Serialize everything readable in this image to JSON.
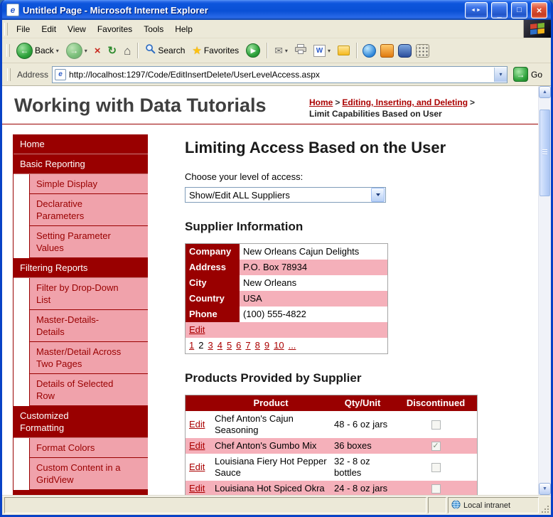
{
  "window": {
    "title": "Untitled Page - Microsoft Internet Explorer",
    "status_zone": "Local intranet"
  },
  "menu": {
    "items": [
      "File",
      "Edit",
      "View",
      "Favorites",
      "Tools",
      "Help"
    ]
  },
  "toolbar": {
    "back_label": "Back",
    "search_label": "Search",
    "favorites_label": "Favorites"
  },
  "address": {
    "label": "Address",
    "url": "http://localhost:1297/Code/EditInsertDelete/UserLevelAccess.aspx",
    "go_label": "Go"
  },
  "page": {
    "site_title": "Working with Data Tutorials",
    "breadcrumb": {
      "links": [
        "Home",
        "Editing, Inserting, and Deleting"
      ],
      "separator": ">",
      "current": "Limit Capabilities Based on User"
    },
    "sidebar": {
      "items": [
        {
          "label": "Home",
          "type": "section"
        },
        {
          "label": "Basic Reporting",
          "type": "section"
        },
        {
          "label": "Simple Display",
          "type": "item"
        },
        {
          "label": "Declarative Parameters",
          "type": "item"
        },
        {
          "label": "Setting Parameter Values",
          "type": "item"
        },
        {
          "label": "Filtering Reports",
          "type": "section"
        },
        {
          "label": "Filter by Drop-Down List",
          "type": "item"
        },
        {
          "label": "Master-Details-Details",
          "type": "item"
        },
        {
          "label": "Master/Detail Across Two Pages",
          "type": "item"
        },
        {
          "label": "Details of Selected Row",
          "type": "item"
        },
        {
          "label": "Customized Formatting",
          "type": "section"
        },
        {
          "label": "Format Colors",
          "type": "item"
        },
        {
          "label": "Custom Content in a GridView",
          "type": "item"
        }
      ]
    },
    "main": {
      "heading": "Limiting Access Based on the User",
      "access_label": "Choose your level of access:",
      "access_value": "Show/Edit ALL Suppliers",
      "supplier_heading": "Supplier Information",
      "supplier": {
        "rows": [
          [
            "Company",
            "New Orleans Cajun Delights"
          ],
          [
            "Address",
            "P.O. Box 78934"
          ],
          [
            "City",
            "New Orleans"
          ],
          [
            "Country",
            "USA"
          ],
          [
            "Phone",
            "(100) 555-4822"
          ]
        ],
        "edit_label": "Edit",
        "pager": [
          "1",
          "2",
          "3",
          "4",
          "5",
          "6",
          "7",
          "8",
          "9",
          "10",
          "..."
        ],
        "current_page": "2"
      },
      "products_heading": "Products Provided by Supplier",
      "products": {
        "headers": [
          "",
          "Product",
          "Qty/Unit",
          "Discontinued"
        ],
        "edit_label": "Edit",
        "rows": [
          {
            "product": "Chef Anton's Cajun Seasoning",
            "qty": "48 - 6 oz jars",
            "discontinued": false
          },
          {
            "product": "Chef Anton's Gumbo Mix",
            "qty": "36 boxes",
            "discontinued": true
          },
          {
            "product": "Louisiana Fiery Hot Pepper Sauce",
            "qty": "32 - 8 oz bottles",
            "discontinued": false
          },
          {
            "product": "Louisiana Hot Spiced Okra",
            "qty": "24 - 8 oz jars",
            "discontinued": false
          }
        ]
      }
    }
  },
  "icons": {
    "ie_logo": "e",
    "back_arrow": "←",
    "forward_arrow": "→",
    "stop": "×",
    "refresh": "↻",
    "home": "⌂",
    "star": "★",
    "media_play": "▶",
    "mail": "✉",
    "word_w": "W",
    "go_arrow": "→",
    "caret_down": "▾",
    "scroll_up": "▲",
    "scroll_down": "▼",
    "check": "✓",
    "title_extra": "◄►",
    "minimize": "_",
    "maximize": "□",
    "close": "×"
  },
  "colors": {
    "dark_red": "#990000",
    "sidebar_pink": "#F0A2AB",
    "row_pink": "#F5B0BA",
    "link_red": "#AA0000"
  }
}
